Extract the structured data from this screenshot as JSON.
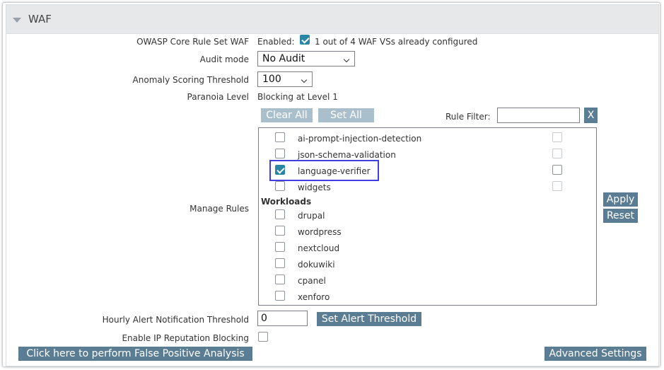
{
  "panel": {
    "title": "WAF"
  },
  "owasp": {
    "label": "OWASP Core Rule Set WAF",
    "enabled_label": "Enabled:",
    "enabled": true,
    "status_text": "1 out of 4 WAF VSs already configured"
  },
  "audit_mode": {
    "label": "Audit mode",
    "value": "No Audit"
  },
  "anomaly": {
    "label": "Anomaly Scoring Threshold",
    "value": "100"
  },
  "paranoia": {
    "label": "Paranoia Level",
    "value": "Blocking at Level 1"
  },
  "rules_toolbar": {
    "clear_all": "Clear All",
    "set_all": "Set All",
    "filter_label": "Rule Filter:",
    "filter_value": "",
    "filter_clear": "X"
  },
  "manage_rules": {
    "label": "Manage Rules",
    "rules": [
      {
        "name": "ai-prompt-injection-detection",
        "checked": false
      },
      {
        "name": "json-schema-validation",
        "checked": false
      },
      {
        "name": "language-verifier",
        "checked": true
      },
      {
        "name": "widgets",
        "checked": false
      }
    ],
    "group_label": "Workloads",
    "workloads": [
      {
        "name": "drupal",
        "checked": false
      },
      {
        "name": "wordpress",
        "checked": false
      },
      {
        "name": "nextcloud",
        "checked": false
      },
      {
        "name": "dokuwiki",
        "checked": false
      },
      {
        "name": "cpanel",
        "checked": false
      },
      {
        "name": "xenforo",
        "checked": false
      }
    ],
    "apply": "Apply",
    "reset": "Reset"
  },
  "hourly_alert": {
    "label": "Hourly Alert Notification Threshold",
    "value": "0",
    "button": "Set Alert Threshold"
  },
  "ip_reputation": {
    "label": "Enable IP Reputation Blocking",
    "checked": false
  },
  "footer": {
    "false_positive": "Click here to perform False Positive Analysis",
    "advanced": "Advanced Settings"
  },
  "colors": {
    "button": "#5b7d93",
    "button_disabled": "#aabfcc",
    "checkbox_checked": "#2a86a4",
    "highlight": "#3d3fe0"
  }
}
